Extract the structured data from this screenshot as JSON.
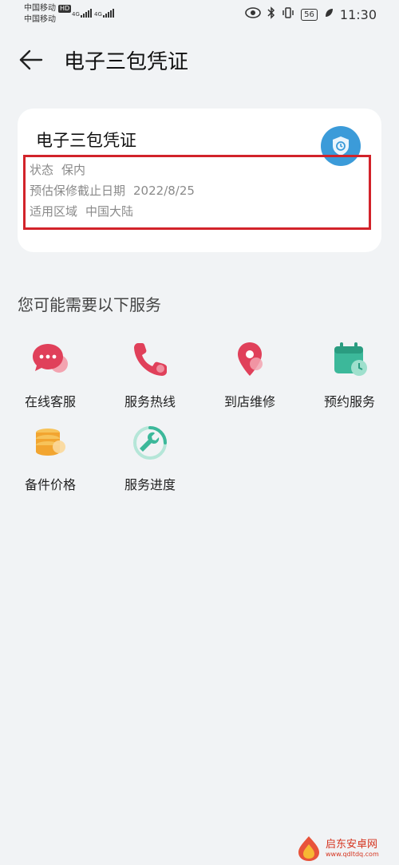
{
  "status_bar": {
    "carrier1": "中国移动",
    "carrier1_badge": "HD",
    "carrier2": "中国移动",
    "net1": "4G",
    "net2": "4G",
    "battery": "56",
    "time": "11:30"
  },
  "header": {
    "title": "电子三包凭证"
  },
  "card": {
    "title": "电子三包凭证",
    "rows": [
      {
        "label": "状态",
        "value": "保内"
      },
      {
        "label": "预估保修截止日期",
        "value": "2022/8/25"
      },
      {
        "label": "适用区域",
        "value": "中国大陆"
      }
    ]
  },
  "services": {
    "title": "您可能需要以下服务",
    "items": [
      {
        "label": "在线客服",
        "icon": "chat-bubble-icon"
      },
      {
        "label": "服务热线",
        "icon": "phone-icon"
      },
      {
        "label": "到店维修",
        "icon": "location-pin-icon"
      },
      {
        "label": "预约服务",
        "icon": "calendar-clock-icon"
      },
      {
        "label": "备件价格",
        "icon": "coin-stack-icon"
      },
      {
        "label": "服务进度",
        "icon": "wrench-progress-icon"
      }
    ]
  },
  "watermark": {
    "text": "启东安卓网",
    "url": "www.qdltdq.com"
  },
  "colors": {
    "highlight_border": "#d2232a",
    "badge_blue": "#3b9bd9",
    "icon_red": "#e0405a",
    "icon_teal": "#3cb89a",
    "icon_orange": "#f2a530"
  }
}
